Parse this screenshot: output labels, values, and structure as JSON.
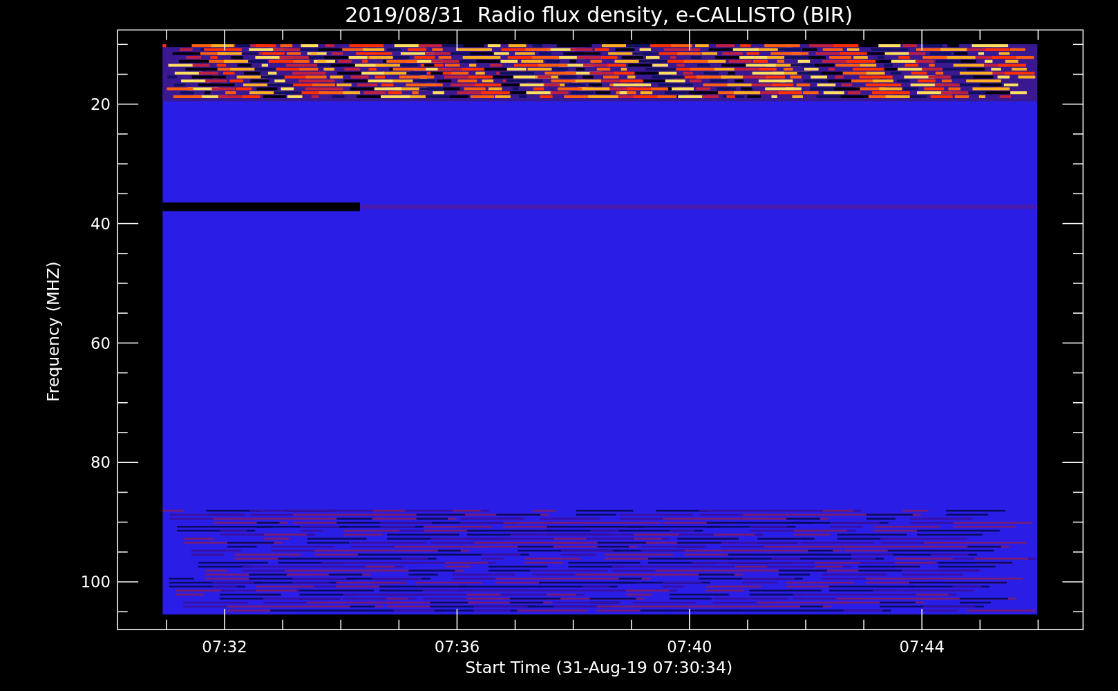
{
  "plot": {
    "title": "2019/08/31  Radio flux density, e-CALLISTO (BIR)",
    "ylabel": "Frequency (MHZ)",
    "xlabel": "Start Time (31-Aug-19 07:30:34)",
    "yticks": [
      "20",
      "40",
      "60",
      "80",
      "100"
    ],
    "xticks": [
      "07:32",
      "07:36",
      "07:40",
      "07:44"
    ]
  }
}
